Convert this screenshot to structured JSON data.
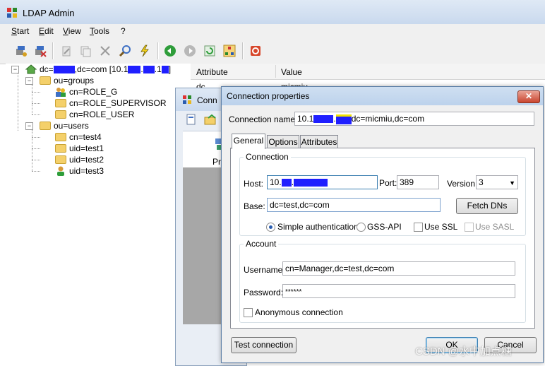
{
  "app": {
    "title": "LDAP Admin"
  },
  "menu": [
    "Start",
    "Edit",
    "View",
    "Tools",
    "?"
  ],
  "toolbar": {
    "icons": [
      "connect-icon",
      "disconnect-icon",
      "edit-icon",
      "copy-icon",
      "delete-icon",
      "search-icon",
      "flash-icon",
      "back-icon",
      "forward-icon",
      "refresh-icon",
      "schema-icon",
      "stop-icon"
    ]
  },
  "tree": {
    "root_label": "dc=████,dc=com [10.1██.██.1██]",
    "root_prefix": "dc=",
    "root_mid": ",dc=com [10.1",
    "nodes": [
      {
        "label": "ou=groups"
      },
      {
        "label": "cn=ROLE_G"
      },
      {
        "label": "cn=ROLE_SUPERVISOR"
      },
      {
        "label": "cn=ROLE_USER"
      },
      {
        "label": "ou=users"
      },
      {
        "label": "cn=test4"
      },
      {
        "label": "uid=test1"
      },
      {
        "label": "uid=test2"
      },
      {
        "label": "uid=test3"
      }
    ]
  },
  "attributes": {
    "headers": [
      "Attribute",
      "Value"
    ],
    "first_row": [
      "dc",
      "micmiu"
    ]
  },
  "back_dialog": {
    "title_fragment": "Conn",
    "button_fragment": "Pr"
  },
  "dialog": {
    "title": "Connection properties",
    "connection_name_label": "Connection name:",
    "connection_name_prefix": "10.1",
    "connection_name_suffix": "dc=micmiu,dc=com",
    "tabs": [
      "General",
      "Options",
      "Attributes"
    ],
    "connection_group": "Connection",
    "host_label": "Host:",
    "host_value_prefix": "10.",
    "port_label": "Port:",
    "port_value": "389",
    "version_label": "Version:",
    "version_value": "3",
    "base_label": "Base:",
    "base_value": "dc=test,dc=com",
    "fetch_dns": "Fetch DNs",
    "auth_simple": "Simple authentication",
    "auth_gss": "GSS-API",
    "use_ssl": "Use SSL",
    "use_sasl": "Use SASL",
    "account_group": "Account",
    "username_label": "Username:",
    "username_value": "cn=Manager,dc=test,dc=com",
    "password_label": "Password:",
    "password_value": "******",
    "anonymous": "Anonymous connection",
    "test_connection": "Test connection",
    "ok": "OK",
    "cancel": "Cancel"
  },
  "watermark": "CSDN @水中加点糖",
  "colors": {
    "redaction": "#1f1fff",
    "dialog_border": "#5d7fa6",
    "title_gradient": "#cfdff1"
  }
}
